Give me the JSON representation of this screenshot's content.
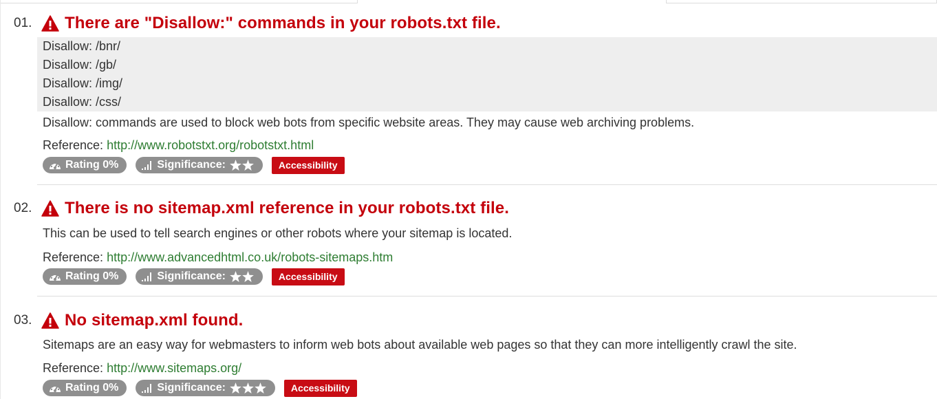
{
  "issues": [
    {
      "number": "01.",
      "title": "There are \"Disallow:\" commands in your robots.txt file.",
      "code_lines": [
        "Disallow: /bnr/",
        "Disallow: /gb/",
        "Disallow: /img/",
        "Disallow: /css/"
      ],
      "description": "Disallow: commands are used to block web bots from specific website areas. They may cause web archiving problems.",
      "reference_label": "Reference:",
      "reference_url": "http://www.robotstxt.org/robotstxt.html",
      "rating": "Rating 0%",
      "significance": "Significance:",
      "stars": 2,
      "category": "Accessibility"
    },
    {
      "number": "02.",
      "title": "There is no sitemap.xml reference in your robots.txt file.",
      "description": "This can be used to tell search engines or other robots where your sitemap is located.",
      "reference_label": "Reference:",
      "reference_url": "http://www.advancedhtml.co.uk/robots-sitemaps.htm",
      "rating": "Rating 0%",
      "significance": "Significance:",
      "stars": 2,
      "category": "Accessibility"
    },
    {
      "number": "03.",
      "title": "No sitemap.xml found.",
      "description": "Sitemaps are an easy way for webmasters to inform web bots about available web pages so that they can more intelligently crawl the site.",
      "reference_label": "Reference:",
      "reference_url": "http://www.sitemaps.org/",
      "rating": "Rating 0%",
      "significance": "Significance:",
      "stars": 3,
      "category": "Accessibility"
    }
  ],
  "colors": {
    "title_red": "#c4000b",
    "link_green": "#2e7d32",
    "badge_grey": "#8f8f8f",
    "category_red": "#c80c14"
  },
  "icons": {
    "warning": "warning-triangle-icon",
    "rating": "dashboard-gauge-icon",
    "significance": "signal-bars-icon",
    "star": "star-icon"
  }
}
